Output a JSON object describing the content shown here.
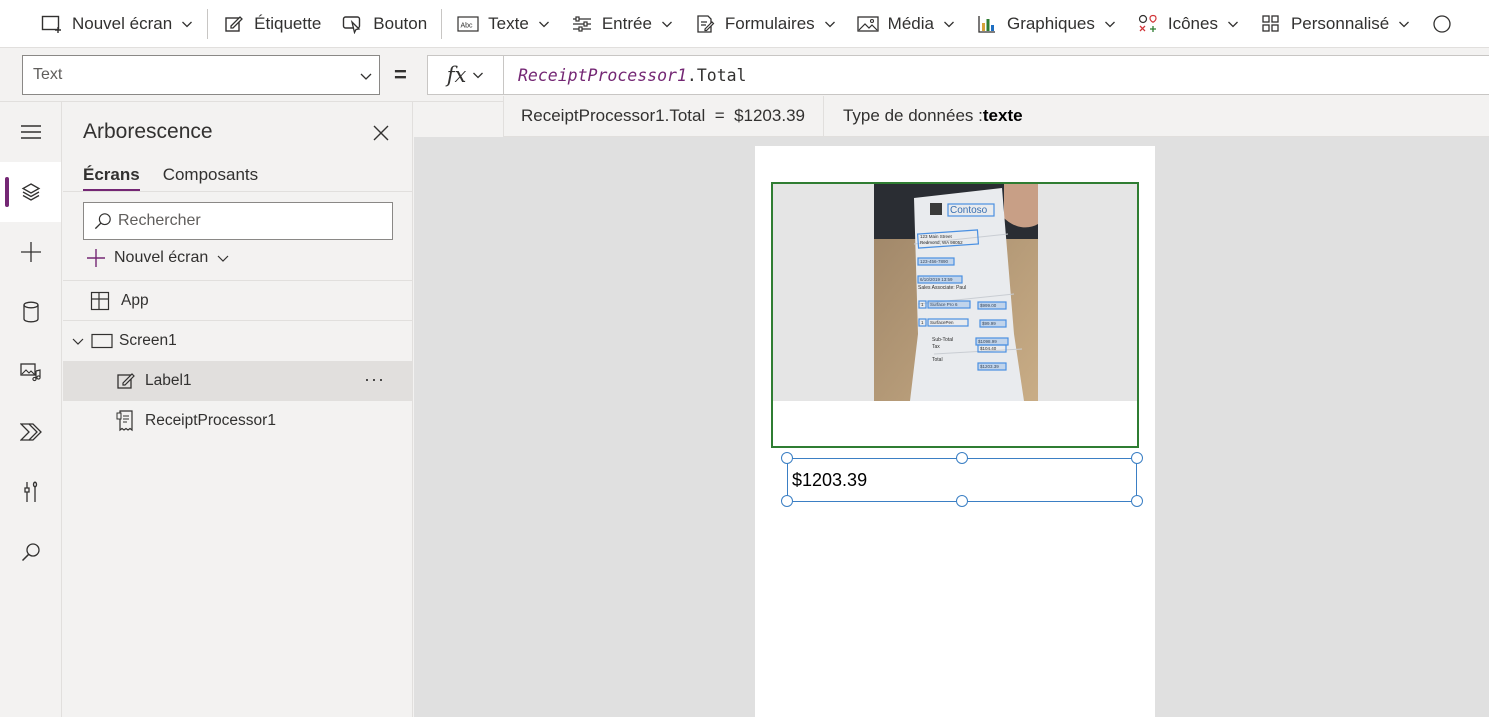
{
  "commandbar": {
    "new_screen": "Nouvel écran",
    "label": "Étiquette",
    "button": "Bouton",
    "text": "Texte",
    "input": "Entrée",
    "forms": "Formulaires",
    "media": "Média",
    "charts": "Graphiques",
    "icons": "Icônes",
    "custom": "Personnalisé"
  },
  "formula_bar": {
    "property": "Text",
    "equals": "=",
    "fx": "fx",
    "formula_object": "ReceiptProcessor1",
    "formula_member": ".Total",
    "result_expression": "ReceiptProcessor1.Total  =  $1203.39",
    "datatype_label": "Type de données :",
    "datatype_value": "texte"
  },
  "tree": {
    "title": "Arborescence",
    "tabs": [
      "Écrans",
      "Composants"
    ],
    "search_placeholder": "Rechercher",
    "new_screen": "Nouvel écran",
    "items": [
      {
        "label": "App"
      },
      {
        "label": "Screen1"
      },
      {
        "label": "Label1"
      },
      {
        "label": "ReceiptProcessor1"
      }
    ]
  },
  "canvas": {
    "label_value": "$1203.39",
    "receipt": {
      "brand": "Contoso",
      "address_1": "123 Main Street",
      "address_2": "Redmond, WA 98052",
      "phone": "123-456-7890",
      "date": "6/10/2019 13:59",
      "associate": "Sales Associate: Paul",
      "line_1_qty": "1",
      "line_1_item": "Surface Pro 6",
      "line_1_price": "$999.00",
      "line_2_qty": "1",
      "line_2_item": "SurfacePen",
      "line_2_price": "$99.99",
      "subtotal_label": "Sub-Total",
      "subtotal_value": "$1098.99",
      "tax_label": "Tax",
      "tax_value": "$104.40",
      "total_label": "Total",
      "total_value": "$1203.39"
    }
  },
  "colors": {
    "accent": "#742774",
    "selection_blue": "#3b7fc4",
    "control_border_green": "#2f7d32",
    "canvas_bg": "#e0e0e0"
  },
  "icons": [
    "new-screen-icon",
    "label-icon",
    "button-icon",
    "text-icon",
    "input-icon",
    "forms-icon",
    "media-icon",
    "charts-icon",
    "icons-icon",
    "custom-icon",
    "hamburger-icon",
    "layers-icon",
    "plus-icon",
    "database-icon",
    "media-rail-icon",
    "power-automate-icon",
    "tools-icon",
    "search-icon",
    "close-icon",
    "app-icon",
    "screen-icon",
    "label-edit-icon",
    "receipt-processor-icon",
    "chevron-down-icon"
  ]
}
